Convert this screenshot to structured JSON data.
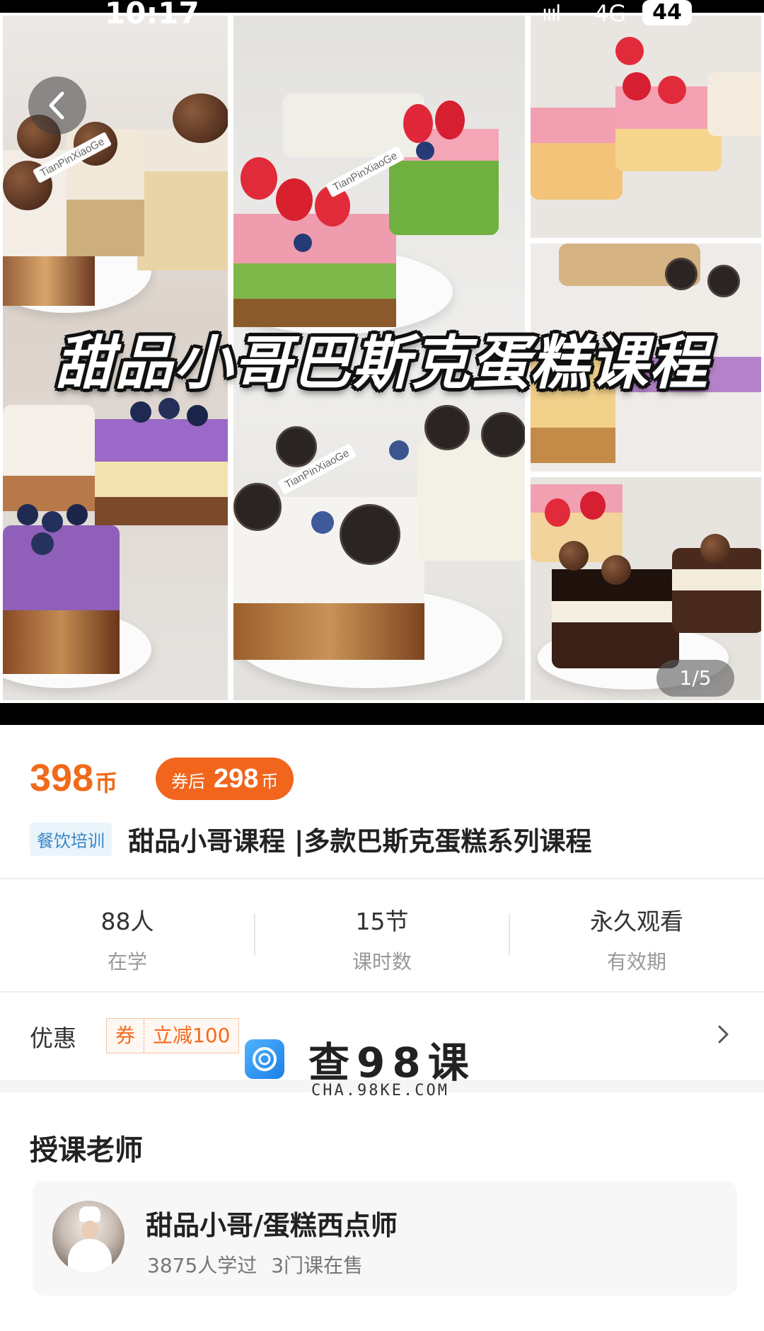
{
  "status_bar": {
    "time": "10:17",
    "signal": "ıııl",
    "network": "4G",
    "battery": "44"
  },
  "hero": {
    "banner_title": "甜品小哥巴斯克蛋糕课程",
    "image_counter": "1/5",
    "cake_tag_text": "TianPinXiaoGe"
  },
  "price": {
    "original": "398",
    "currency": "币",
    "coupon_label": "券后",
    "after_coupon": "298",
    "after_coupon_unit": "币"
  },
  "course": {
    "category": "餐饮培训",
    "title": "甜品小哥课程 |多款巴斯克蛋糕系列课程"
  },
  "stats": [
    {
      "value": "88人",
      "label": "在学"
    },
    {
      "value": "15节",
      "label": "课时数"
    },
    {
      "value": "永久观看",
      "label": "有效期"
    }
  ],
  "discount": {
    "label": "优惠",
    "coupon_tag": "券",
    "coupon_text": "立减100"
  },
  "watermark": {
    "title": "查98课",
    "subtitle": "CHA.98KE.COM"
  },
  "teacher_section": {
    "heading": "授课老师",
    "name": "甜品小哥/蛋糕西点师",
    "students": "3875人学过",
    "courses": "3门课在售"
  },
  "colors": {
    "accent": "#f06a1a",
    "category_bg": "#eaf4fb",
    "category_text": "#3a86c4"
  }
}
